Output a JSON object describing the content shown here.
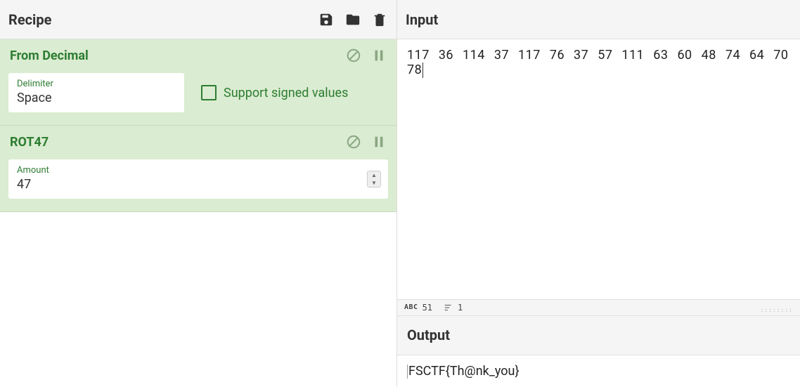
{
  "recipe": {
    "title": "Recipe",
    "operations": [
      {
        "name": "From Decimal",
        "fields": {
          "delimiter": {
            "label": "Delimiter",
            "value": "Space"
          },
          "signed": {
            "label": "Support signed values",
            "checked": false
          }
        }
      },
      {
        "name": "ROT47",
        "fields": {
          "amount": {
            "label": "Amount",
            "value": "47"
          }
        }
      }
    ]
  },
  "input": {
    "title": "Input",
    "text": "117 36 114 37 117 76 37 57 111 63 60 48 74 64 70 78"
  },
  "status": {
    "char_count": "51",
    "line_count": "1",
    "abc_label": "ABC"
  },
  "output": {
    "title": "Output",
    "text": "FSCTF{Th@nk_you}"
  }
}
